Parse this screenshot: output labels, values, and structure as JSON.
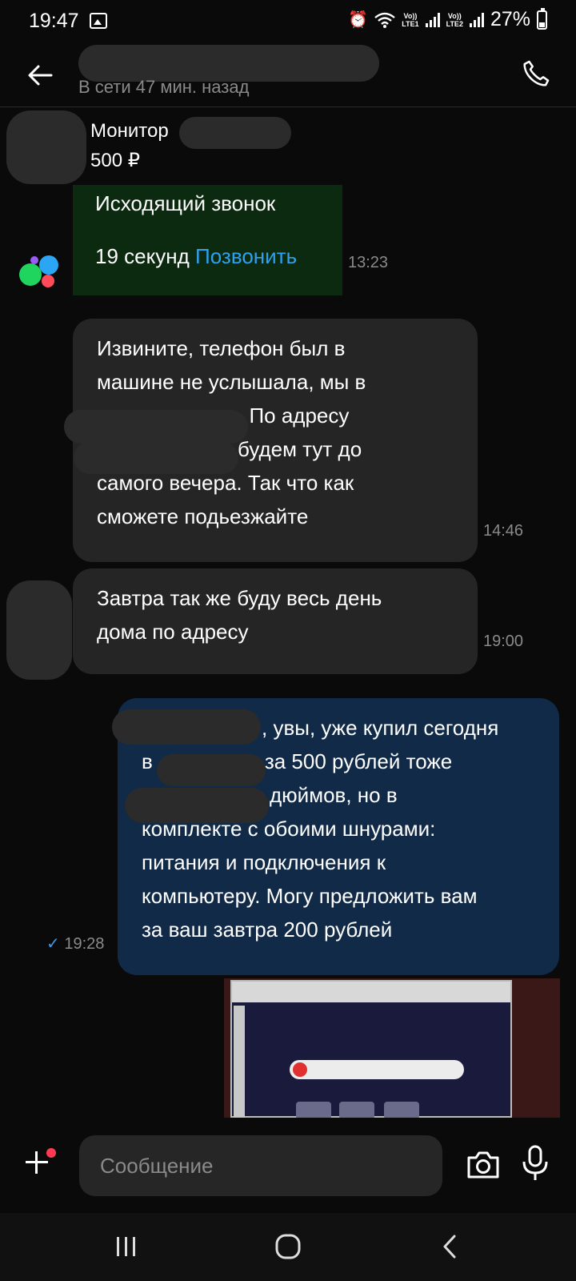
{
  "status_bar": {
    "time": "19:47",
    "sim1_label_top": "Vo))",
    "sim1_label_bottom": "LTE1",
    "sim2_label_top": "Vo))",
    "sim2_label_bottom": "LTE2",
    "battery_text": "27%",
    "battery_level": 0.27,
    "icons": [
      "gallery-icon",
      "alarm-icon",
      "wifi-icon",
      "signal-icon",
      "battery-icon"
    ]
  },
  "header": {
    "status": "В сети 47 мин. назад",
    "icons": [
      "back-arrow-icon",
      "phone-icon"
    ]
  },
  "listing": {
    "title": "Монитор",
    "price": "500 ₽"
  },
  "call": {
    "title": "Исходящий звонок",
    "duration": "19 секунд",
    "action": "Позвонить",
    "time": "13:23"
  },
  "messages": [
    {
      "direction": "incoming",
      "lines": [
        "Извините, телефон был в",
        "машине не услышала, мы в",
        ". По адресу",
        "будем тут до",
        "самого вечера. Так что как",
        "сможете подьезжайте"
      ],
      "time": "14:46"
    },
    {
      "direction": "incoming",
      "lines": [
        "Завтра так же буду весь день",
        "дома по адресу"
      ],
      "time": "19:00"
    },
    {
      "direction": "outgoing",
      "lines": [
        ", увы, уже купил сегодня",
        "в",
        "за 500 рублей тоже",
        "дюймов, но в",
        "комплекте с обоими шнурами:",
        "питания и подключения к",
        "компьютеру. Могу предложить вам",
        "за ваш завтра 200 рублей"
      ],
      "time": "19:28",
      "read_mark": "✓"
    }
  ],
  "composer": {
    "placeholder": "Сообщение",
    "icons": [
      "plus-icon",
      "camera-icon",
      "microphone-icon"
    ]
  },
  "colors": {
    "background": "#0a0a0a",
    "incoming_bubble": "#252525",
    "outgoing_bubble": "#102a48",
    "call_bubble": "#0b2a10",
    "link": "#2da3f0",
    "notification_dot": "#ff3b52"
  }
}
